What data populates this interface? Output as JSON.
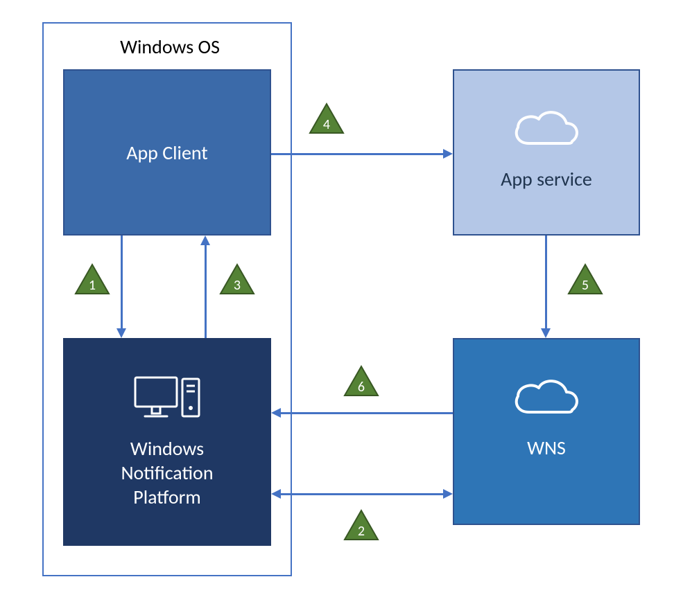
{
  "container": {
    "title": "Windows OS"
  },
  "nodes": {
    "app_client": {
      "label": "App Client"
    },
    "wnp": {
      "label": "Windows\nNotification\nPlatform"
    },
    "app_service": {
      "label": "App service"
    },
    "wns": {
      "label": "WNS"
    }
  },
  "steps": {
    "s1": "1",
    "s2": "2",
    "s3": "3",
    "s4": "4",
    "s5": "5",
    "s6": "6"
  },
  "icons": {
    "cloud_app_service": "cloud",
    "cloud_wns": "cloud",
    "wnp_device": "desktop-tower"
  },
  "colors": {
    "border_blue": "#4472C4",
    "app_client_bg": "#3B6AA9",
    "wnp_bg": "#1F3864",
    "app_service_bg": "#B4C7E7",
    "wns_bg": "#2E75B6",
    "triangle_fill": "#548235",
    "triangle_stroke": "#385723",
    "text_dark": "#20354F",
    "text_white": "#FFFFFF"
  },
  "chart_data": {
    "type": "table",
    "nodes": [
      {
        "id": "app_client",
        "label": "App Client",
        "group": "Windows OS"
      },
      {
        "id": "wnp",
        "label": "Windows Notification Platform",
        "group": "Windows OS"
      },
      {
        "id": "app_service",
        "label": "App service",
        "group": ""
      },
      {
        "id": "wns",
        "label": "WNS",
        "group": ""
      }
    ],
    "edges": [
      {
        "step": 1,
        "from": "app_client",
        "to": "wnp",
        "direction": "one-way"
      },
      {
        "step": 2,
        "from": "wnp",
        "to": "wns",
        "direction": "two-way"
      },
      {
        "step": 3,
        "from": "wnp",
        "to": "app_client",
        "direction": "one-way"
      },
      {
        "step": 4,
        "from": "app_client",
        "to": "app_service",
        "direction": "one-way"
      },
      {
        "step": 5,
        "from": "app_service",
        "to": "wns",
        "direction": "one-way"
      },
      {
        "step": 6,
        "from": "wns",
        "to": "wnp",
        "direction": "one-way"
      }
    ],
    "title": "",
    "xlabel": "",
    "ylabel": ""
  }
}
